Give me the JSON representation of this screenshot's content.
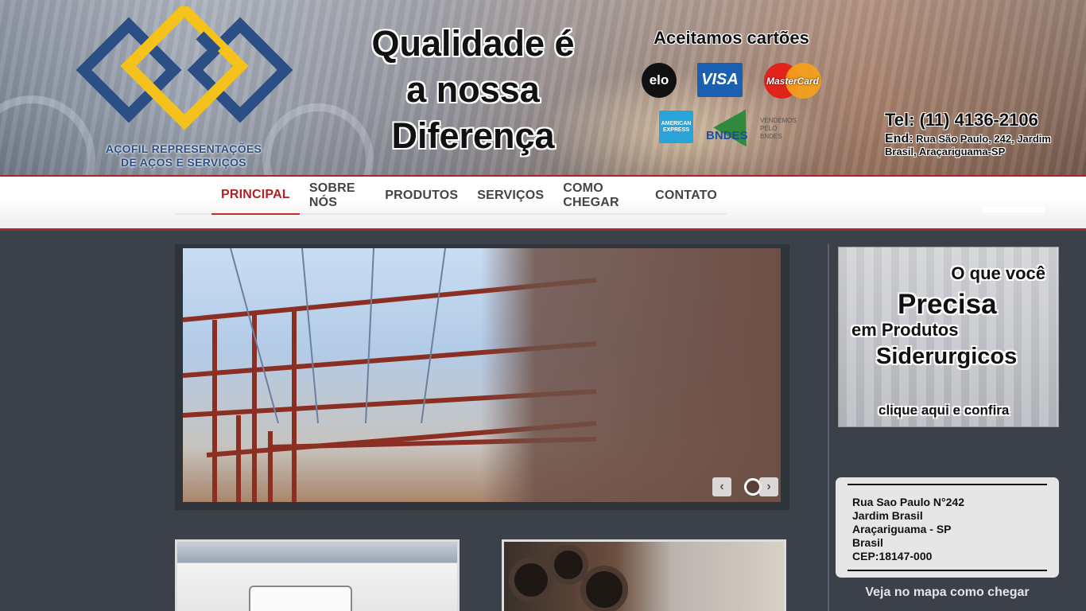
{
  "header": {
    "logo_lines": [
      "AÇOFIL REPRESENTAÇÕES",
      "DE AÇOS E SERVIÇOS"
    ],
    "slogan_lines": [
      "Qualidade é",
      "a nossa",
      "Diferença"
    ],
    "cards_title": "Aceitamos cartões",
    "cards": {
      "elo": "elo",
      "visa": "VISA",
      "mastercard": "MasterCard",
      "amex": "AMERICAN EXPRESS",
      "bndes": "BNDES",
      "bndes_note": "VENDEMOS PELO BNDES"
    },
    "tel": "Tel: (11) 4136-2106",
    "end_label": "End:",
    "end_text": "Rua São Paulo, 242, Jardim Brasil, Araçariguama-SP"
  },
  "nav": {
    "items": [
      {
        "label": "PRINCIPAL",
        "active": true
      },
      {
        "label": "SOBRE NÓS",
        "active": false
      },
      {
        "label": "PRODUTOS",
        "active": false
      },
      {
        "label": "SERVIÇOS",
        "active": false
      },
      {
        "label": "COMO CHEGAR",
        "active": false
      },
      {
        "label": "CONTATO",
        "active": false
      }
    ],
    "accent_color": "#b02222"
  },
  "slider": {
    "prev_icon": "chevron-left-icon",
    "next_icon": "chevron-right-icon",
    "prev_glyph": "‹",
    "next_glyph": "›"
  },
  "promo": {
    "line1": "O que você",
    "line2": "Precisa",
    "line3": "em Produtos",
    "line4": "Siderurgicos",
    "cta": "clique aqui e confira"
  },
  "address": {
    "lines": [
      "Rua Sao Paulo N°242",
      "Jardim Brasil",
      "Araçariguama - SP",
      "Brasil",
      "CEP:18147-000"
    ],
    "map_link": "Veja no mapa como chegar"
  }
}
